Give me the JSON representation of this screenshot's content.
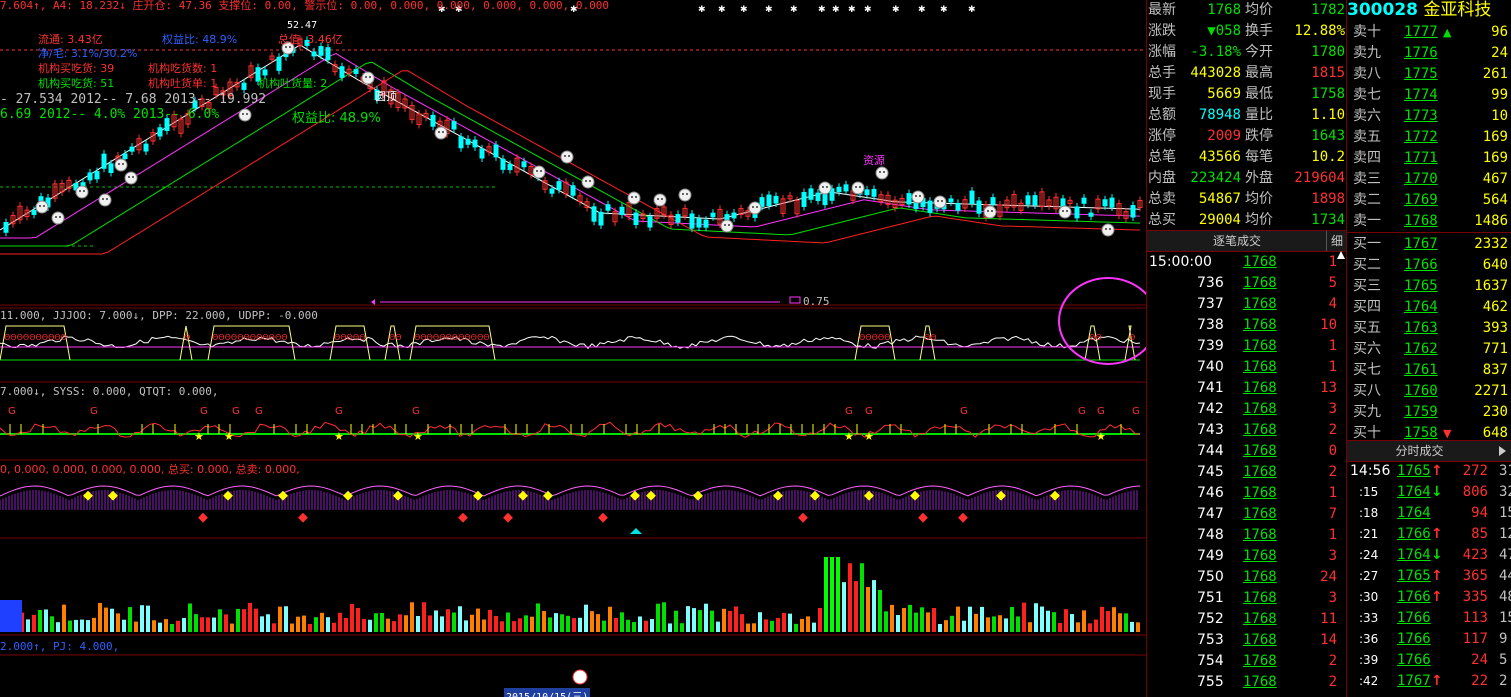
{
  "stock": {
    "code": "300028",
    "name": "金亚科技"
  },
  "colors": {
    "up": "#ff3030",
    "down": "#00e000",
    "flat": "#c0c0c0",
    "yellow": "#ffff00",
    "cyan": "#00ffff",
    "grid": "#7a0000",
    "magenta": "#ff33ff"
  },
  "quote": [
    {
      "label": "最新",
      "value": "1768",
      "label2": "均价",
      "value2": "1782"
    },
    {
      "label": "涨跌",
      "value": "▼058",
      "label2": "换手",
      "value2": "12.88%"
    },
    {
      "label": "涨幅",
      "value": "-3.18%",
      "label2": "今开",
      "value2": "1780"
    },
    {
      "label": "总手",
      "value": "443028",
      "label2": "最高",
      "value2": "1815"
    },
    {
      "label": "现手",
      "value": "5669",
      "label2": "最低",
      "value2": "1758"
    },
    {
      "label": "总额",
      "value": "78948",
      "label2": "量比",
      "value2": "1.10"
    },
    {
      "label": "涨停",
      "value": "2009",
      "label2": "跌停",
      "value2": "1643"
    },
    {
      "label": "总笔",
      "value": "43566",
      "label2": "每笔",
      "value2": "10.2"
    },
    {
      "label": "内盘",
      "value": "223424",
      "label2": "外盘",
      "value2": "219604"
    },
    {
      "label": "总卖",
      "value": "54867",
      "label2": "均价",
      "value2": "1898"
    },
    {
      "label": "总买",
      "value": "29004",
      "label2": "均价",
      "value2": "1734"
    }
  ],
  "book": [
    {
      "label": "卖十",
      "price": "1777",
      "vol": "96",
      "flag": "▲"
    },
    {
      "label": "卖九",
      "price": "1776",
      "vol": "24",
      "flag": ""
    },
    {
      "label": "卖八",
      "price": "1775",
      "vol": "261",
      "flag": ""
    },
    {
      "label": "卖七",
      "price": "1774",
      "vol": "99",
      "flag": ""
    },
    {
      "label": "卖六",
      "price": "1773",
      "vol": "10",
      "flag": ""
    },
    {
      "label": "卖五",
      "price": "1772",
      "vol": "169",
      "flag": ""
    },
    {
      "label": "卖四",
      "price": "1771",
      "vol": "169",
      "flag": ""
    },
    {
      "label": "卖三",
      "price": "1770",
      "vol": "467",
      "flag": ""
    },
    {
      "label": "卖二",
      "price": "1769",
      "vol": "564",
      "flag": ""
    },
    {
      "label": "卖一",
      "price": "1768",
      "vol": "1486",
      "flag": ""
    },
    {
      "label": "买一",
      "price": "1767",
      "vol": "2332",
      "flag": ""
    },
    {
      "label": "买二",
      "price": "1766",
      "vol": "640",
      "flag": ""
    },
    {
      "label": "买三",
      "price": "1765",
      "vol": "1637",
      "flag": ""
    },
    {
      "label": "买四",
      "price": "1764",
      "vol": "462",
      "flag": ""
    },
    {
      "label": "买五",
      "price": "1763",
      "vol": "393",
      "flag": ""
    },
    {
      "label": "买六",
      "price": "1762",
      "vol": "771",
      "flag": ""
    },
    {
      "label": "买七",
      "price": "1761",
      "vol": "837",
      "flag": ""
    },
    {
      "label": "买八",
      "price": "1760",
      "vol": "2271",
      "flag": ""
    },
    {
      "label": "买九",
      "price": "1759",
      "vol": "230",
      "flag": ""
    },
    {
      "label": "买十",
      "price": "1758",
      "vol": "648",
      "flag": "▼"
    }
  ],
  "ticks_title": "逐笔成交",
  "ticks_detail": "细",
  "ticks": [
    {
      "time": "15:00:00",
      "price": "1768",
      "vol": "1"
    },
    {
      "time": "736",
      "price": "1768",
      "vol": "5"
    },
    {
      "time": "737",
      "price": "1768",
      "vol": "4"
    },
    {
      "time": "738",
      "price": "1768",
      "vol": "10"
    },
    {
      "time": "739",
      "price": "1768",
      "vol": "1"
    },
    {
      "time": "740",
      "price": "1768",
      "vol": "1"
    },
    {
      "time": "741",
      "price": "1768",
      "vol": "13"
    },
    {
      "time": "742",
      "price": "1768",
      "vol": "3"
    },
    {
      "time": "743",
      "price": "1768",
      "vol": "2"
    },
    {
      "time": "744",
      "price": "1768",
      "vol": "0"
    },
    {
      "time": "745",
      "price": "1768",
      "vol": "2"
    },
    {
      "time": "746",
      "price": "1768",
      "vol": "1"
    },
    {
      "time": "747",
      "price": "1768",
      "vol": "7"
    },
    {
      "time": "748",
      "price": "1768",
      "vol": "1"
    },
    {
      "time": "749",
      "price": "1768",
      "vol": "3"
    },
    {
      "time": "750",
      "price": "1768",
      "vol": "24"
    },
    {
      "time": "751",
      "price": "1768",
      "vol": "3"
    },
    {
      "time": "752",
      "price": "1768",
      "vol": "11"
    },
    {
      "time": "753",
      "price": "1768",
      "vol": "14"
    },
    {
      "time": "754",
      "price": "1768",
      "vol": "2"
    },
    {
      "time": "755",
      "price": "1768",
      "vol": "2"
    }
  ],
  "mini_title": "分时成交",
  "mini": [
    {
      "time": "14:56",
      "price": "1765",
      "dir": "up",
      "vol": "272",
      "extra": "31"
    },
    {
      "time": ":15",
      "price": "1764",
      "dir": "down",
      "vol": "806",
      "extra": "32"
    },
    {
      "time": ":18",
      "price": "1764",
      "dir": "",
      "vol": "94",
      "extra": "15"
    },
    {
      "time": ":21",
      "price": "1766",
      "dir": "up",
      "vol": "85",
      "extra": "12"
    },
    {
      "time": ":24",
      "price": "1764",
      "dir": "down",
      "vol": "423",
      "extra": "47"
    },
    {
      "time": ":27",
      "price": "1765",
      "dir": "up",
      "vol": "365",
      "extra": "44"
    },
    {
      "time": ":30",
      "price": "1766",
      "dir": "up",
      "vol": "335",
      "extra": "48"
    },
    {
      "time": ":33",
      "price": "1766",
      "dir": "",
      "vol": "113",
      "extra": "15"
    },
    {
      "time": ":36",
      "price": "1766",
      "dir": "",
      "vol": "117",
      "extra": "9"
    },
    {
      "time": ":39",
      "price": "1766",
      "dir": "",
      "vol": "24",
      "extra": "5"
    },
    {
      "time": ":42",
      "price": "1767",
      "dir": "up",
      "vol": "22",
      "extra": "2"
    }
  ],
  "chart_text": {
    "top_bar": "7.604↑, A4: 18.232↓ 庄开仓: 47.36 支撑位: 0.00, 警示位: 0.00, 0.000, 0.000, 0.000, 0.000, 0.000",
    "liutong": "流通: 3.43亿",
    "quanyi": "权益比: 48.9%",
    "jing_mao": "净/毛: 3.1%/30.2%",
    "jigou_mai": "机构买吃货: 39",
    "jigou_chi": "机构吃货数: 1",
    "jigou_mai2": "机构买吃货: 51",
    "jigou_tu": "机构吐货单: 1",
    "jigou_tu2": "机构吐货量: 2",
    "row1": "- 27.534   2012-- 7.68   2013-- 19.992",
    "row2": "6.69   2012-- 4.0%   2013-- 6.0%",
    "quanyi2": "权益比: 48.9%",
    "zongzhi": "总值: 3.46亿",
    "price_peak": "52.47",
    "dingtou": "圆顶",
    "yinglang": "资源",
    "arrow_val": "0.75",
    "ind1": "11.000, JJJOO: 7.000↓, DPP: 22.000, UDPP: -0.000",
    "ind2": "7.000↓, SYSS: 0.000, QTQT: 0.000,",
    "ind3": "0, 0.000, 0.000, 0.000, 0.000, 总买: 0.000, 总卖: 0.000,",
    "ind5": "2.000↑, PJ: 4.000,",
    "date_label": "2015/10/15(三)"
  },
  "chart_data": {
    "type": "candlestick-panels",
    "panels": [
      "price",
      "indicator-1",
      "indicator-2",
      "indicator-3",
      "volume",
      "indicator-5"
    ],
    "note_values": [
      "52.47",
      "0.75"
    ]
  }
}
